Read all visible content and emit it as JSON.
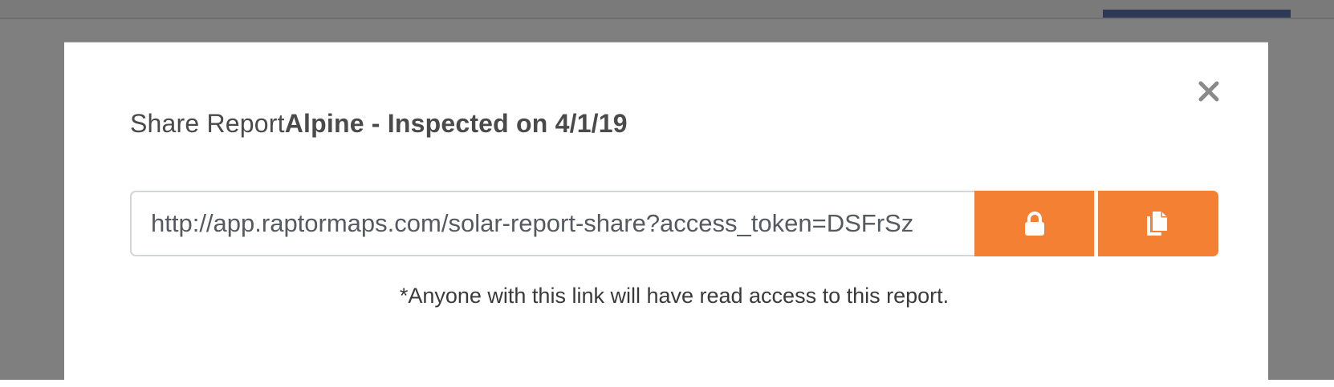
{
  "modal": {
    "title_prefix": "Share Report",
    "report_name": "Alpine - Inspected on 4/1/19",
    "share_url": "http://app.raptormaps.com/solar-report-share?access_token=DSFrSz",
    "notice": "*Anyone with this link will have read access to this report."
  },
  "icons": {
    "close": "close-icon",
    "lock": "lock-icon",
    "copy": "copy-icon"
  },
  "colors": {
    "accent": "#f38033",
    "backdrop": "#7f7f7f",
    "header_bar": "#2e3a55"
  }
}
